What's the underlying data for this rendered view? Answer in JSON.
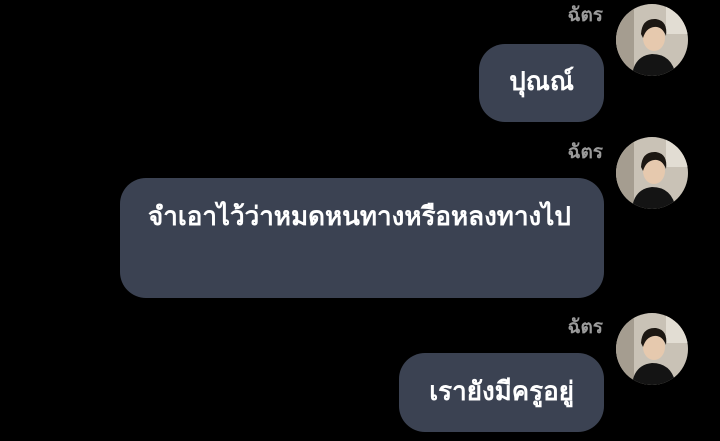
{
  "chat": {
    "messages": [
      {
        "sender": "ฉัตร",
        "text": "ปุณณ์"
      },
      {
        "sender": "ฉัตร",
        "text": "จำเอาไว้ว่าหมดหนทางหรือหลงทางไป"
      },
      {
        "sender": "ฉัตร",
        "text": "เรายังมีครูอยู่"
      }
    ]
  },
  "colors": {
    "background": "#000000",
    "bubble": "#3b4252",
    "bubble_text": "#ffffff",
    "sender_name": "#9a9a9a"
  },
  "icons": {
    "avatar": "user-avatar-photo"
  }
}
